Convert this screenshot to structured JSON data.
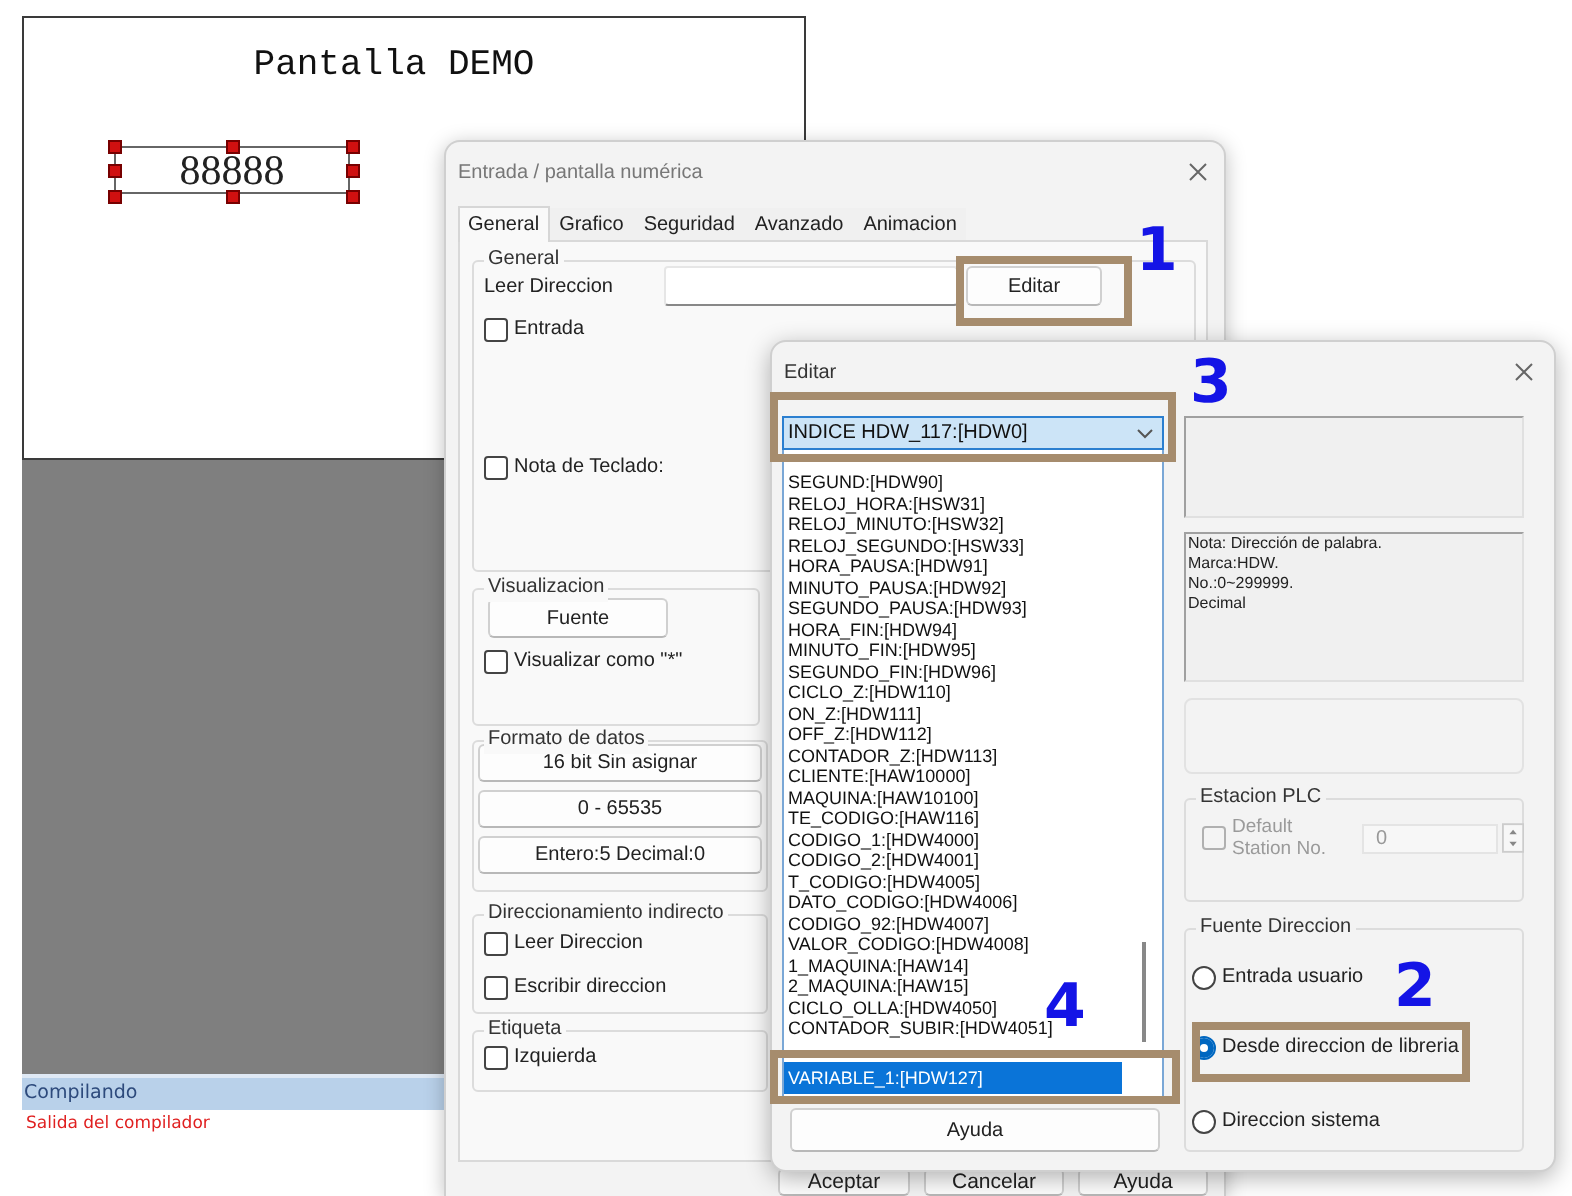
{
  "canvas": {
    "title": "Pantalla DEMO",
    "numeric_display": "88888"
  },
  "compiler_panel": {
    "header": "Compilando",
    "message": "Salida del compilador"
  },
  "entry_dialog": {
    "title": "Entrada / pantalla numérica",
    "tabs": [
      {
        "label": "General",
        "selected": true
      },
      {
        "label": "Grafico",
        "selected": false
      },
      {
        "label": "Seguridad",
        "selected": false
      },
      {
        "label": "Avanzado",
        "selected": false
      },
      {
        "label": "Animacion",
        "selected": false
      }
    ],
    "general": {
      "legend": "General",
      "read_address_label": "Leer Direccion",
      "edit_button": "Editar",
      "options": [
        {
          "label": "Entrada",
          "checked": false
        },
        {
          "label": "Nota de Teclado:",
          "checked": false
        }
      ]
    },
    "display": {
      "legend": "Visualizacion",
      "font_button": "Fuente",
      "options": [
        {
          "label": "Visualizar como \"*\"",
          "checked": false
        }
      ]
    },
    "data_format": {
      "legend": "Formato de datos",
      "buttons": [
        "16 bit Sin asignar",
        "0 - 65535",
        "Entero:5 Decimal:0"
      ]
    },
    "indirect_addressing": {
      "legend": "Direccionamiento indirecto",
      "options": [
        {
          "label": "Leer Direccion",
          "checked": false
        },
        {
          "label": "Escribir direccion",
          "checked": false
        }
      ]
    },
    "tag": {
      "legend": "Etiqueta",
      "options": [
        {
          "label": "Izquierda",
          "checked": false
        }
      ]
    },
    "buttons": [
      "Aceptar",
      "Cancelar",
      "Ayuda"
    ]
  },
  "edit_dialog": {
    "title": "Editar",
    "address": "INDICE HDW_117:[HDW0]",
    "list": [
      {
        "label": "SEGUND:[HDW90]",
        "selected": false
      },
      {
        "label": "RELOJ_HORA:[HSW31]",
        "selected": false
      },
      {
        "label": "RELOJ_MINUTO:[HSW32]",
        "selected": false
      },
      {
        "label": "RELOJ_SEGUNDO:[HSW33]",
        "selected": false
      },
      {
        "label": "HORA_PAUSA:[HDW91]",
        "selected": false
      },
      {
        "label": "MINUTO_PAUSA:[HDW92]",
        "selected": false
      },
      {
        "label": "SEGUNDO_PAUSA:[HDW93]",
        "selected": false
      },
      {
        "label": "HORA_FIN:[HDW94]",
        "selected": false
      },
      {
        "label": "MINUTO_FIN:[HDW95]",
        "selected": false
      },
      {
        "label": "SEGUNDO_FIN:[HDW96]",
        "selected": false
      },
      {
        "label": "CICLO_Z:[HDW110]",
        "selected": false
      },
      {
        "label": "ON_Z:[HDW111]",
        "selected": false
      },
      {
        "label": "OFF_Z:[HDW112]",
        "selected": false
      },
      {
        "label": "CONTADOR_Z:[HDW113]",
        "selected": false
      },
      {
        "label": "CLIENTE:[HAW10000]",
        "selected": false
      },
      {
        "label": "MAQUINA:[HAW10100]",
        "selected": false
      },
      {
        "label": "TE_CODIGO:[HAW116]",
        "selected": false
      },
      {
        "label": "CODIGO_1:[HDW4000]",
        "selected": false
      },
      {
        "label": "CODIGO_2:[HDW4001]",
        "selected": false
      },
      {
        "label": "T_CODIGO:[HDW4005]",
        "selected": false
      },
      {
        "label": "DATO_CODIGO:[HDW4006]",
        "selected": false
      },
      {
        "label": "CODIGO_92:[HDW4007]",
        "selected": false
      },
      {
        "label": "VALOR_CODIGO:[HDW4008]",
        "selected": false
      },
      {
        "label": "1_MAQUINA:[HAW14]",
        "selected": false
      },
      {
        "label": "2_MAQUINA:[HAW15]",
        "selected": false
      },
      {
        "label": "CICLO_OLLA:[HDW4050]",
        "selected": false
      },
      {
        "label": "CONTADOR_SUBIR:[HDW4051]",
        "selected": false
      },
      {
        "label": "VARIABLE_1:[HDW127]",
        "selected": true
      }
    ],
    "help_button": "Ayuda",
    "note": [
      "Nota: Dirección de palabra.",
      "Marca:HDW.",
      "No.:0~299999.",
      "Decimal"
    ],
    "plc_station": {
      "legend": "Estacion PLC",
      "default_station": {
        "label": "Default Station No.",
        "checked": false,
        "disabled": true
      },
      "station_number": "0"
    },
    "address_source": {
      "legend": "Fuente Direccion",
      "options": [
        {
          "label": "Entrada usuario",
          "selected": false
        },
        {
          "label": "Desde direccion de libreria",
          "selected": true
        },
        {
          "label": "Direccion sistema",
          "selected": false
        }
      ]
    }
  },
  "annotations": [
    {
      "number": "1"
    },
    {
      "number": "2"
    },
    {
      "number": "3"
    },
    {
      "number": "4"
    }
  ]
}
